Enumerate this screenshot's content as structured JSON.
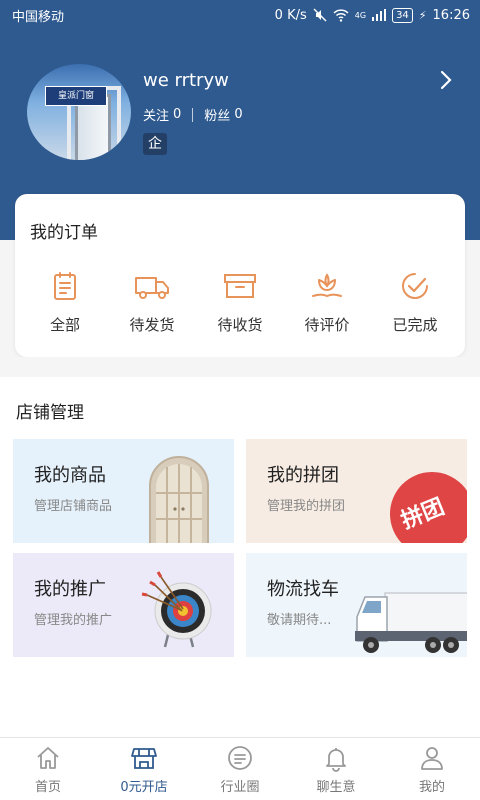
{
  "status_bar": {
    "carrier": "中国移动",
    "speed": "0 K/s",
    "network": "4G",
    "battery": "34",
    "time": "16:26"
  },
  "profile": {
    "avatar_brand": "皇派门窗",
    "username": "we rrtryw",
    "follow_label": "关注",
    "follow_count": "0",
    "fans_label": "粉丝",
    "fans_count": "0",
    "badge": "企"
  },
  "orders": {
    "title": "我的订单",
    "items": [
      {
        "label": "全部",
        "icon": "clipboard-icon"
      },
      {
        "label": "待发货",
        "icon": "truck-icon"
      },
      {
        "label": "待收货",
        "icon": "box-icon"
      },
      {
        "label": "待评价",
        "icon": "flower-icon"
      },
      {
        "label": "已完成",
        "icon": "check-circle-icon"
      }
    ]
  },
  "store": {
    "title": "店铺管理",
    "tiles": [
      {
        "title": "我的商品",
        "subtitle": "管理店铺商品",
        "bg": "#e6f2fb"
      },
      {
        "title": "我的拼团",
        "subtitle": "管理我的拼团",
        "bg": "#f6ece3",
        "stamp": "拼团"
      },
      {
        "title": "我的推广",
        "subtitle": "管理我的推广",
        "bg": "#eceaf8"
      },
      {
        "title": "物流找车",
        "subtitle": "敬请期待...",
        "bg": "#eef5fb"
      }
    ]
  },
  "tabs": [
    {
      "label": "首页",
      "icon": "home-icon",
      "active": false
    },
    {
      "label": "0元开店",
      "icon": "store-icon",
      "active": true
    },
    {
      "label": "行业圈",
      "icon": "chat-icon",
      "active": false
    },
    {
      "label": "聊生意",
      "icon": "bell-icon",
      "active": false
    },
    {
      "label": "我的",
      "icon": "user-icon",
      "active": false
    }
  ],
  "colors": {
    "primary": "#2f5a8f",
    "accent_orange": "#e8935a"
  }
}
